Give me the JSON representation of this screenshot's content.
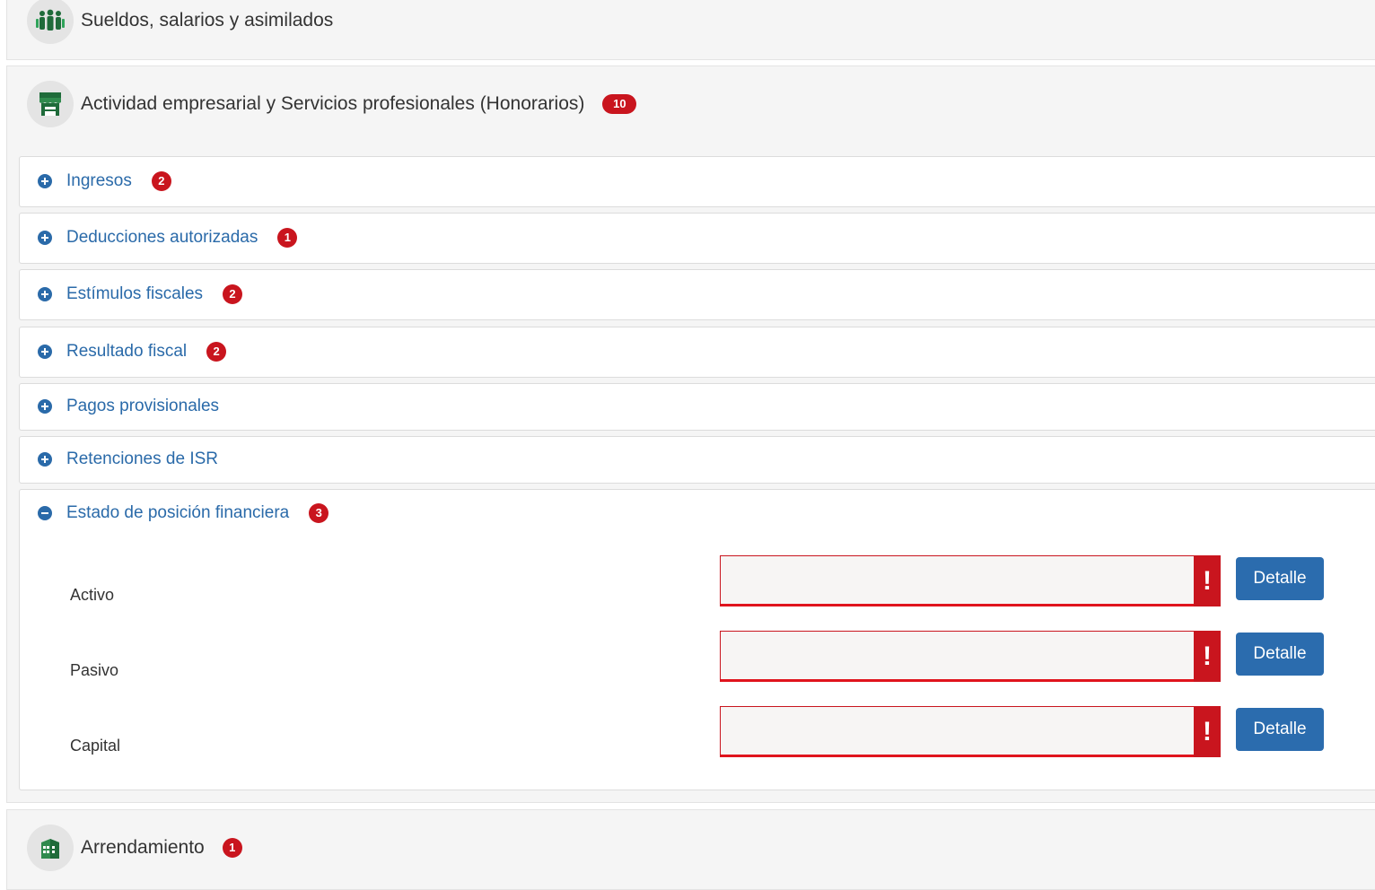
{
  "colors": {
    "badge": "#c9151e",
    "link": "#2a6aa9",
    "button": "#2b6cae",
    "error": "#e0141d",
    "icon_green": "#1f6b3a"
  },
  "sections": [
    {
      "title": "Sueldos, salarios y asimilados",
      "icon": "workers-icon",
      "badge": ""
    },
    {
      "title": "Actividad empresarial y Servicios profesionales (Honorarios)",
      "icon": "store-icon",
      "badge": "10"
    },
    {
      "title": "Arrendamiento",
      "icon": "building-icon",
      "badge": "1"
    }
  ],
  "accordion": [
    {
      "label": "Ingresos",
      "badge": "2",
      "expanded": false
    },
    {
      "label": "Deducciones autorizadas",
      "badge": "1",
      "expanded": false
    },
    {
      "label": "Estímulos fiscales",
      "badge": "2",
      "expanded": false
    },
    {
      "label": "Resultado fiscal",
      "badge": "2",
      "expanded": false
    },
    {
      "label": "Pagos provisionales",
      "badge": "",
      "expanded": false
    },
    {
      "label": "Retenciones de ISR",
      "badge": "",
      "expanded": false
    },
    {
      "label": "Estado de posición financiera",
      "badge": "3",
      "expanded": true
    }
  ],
  "financial_rows": [
    {
      "label": "Activo",
      "value": "",
      "alert": "!",
      "button": "Detalle"
    },
    {
      "label": "Pasivo",
      "value": "",
      "alert": "!",
      "button": "Detalle"
    },
    {
      "label": "Capital",
      "value": "",
      "alert": "!",
      "button": "Detalle"
    }
  ]
}
